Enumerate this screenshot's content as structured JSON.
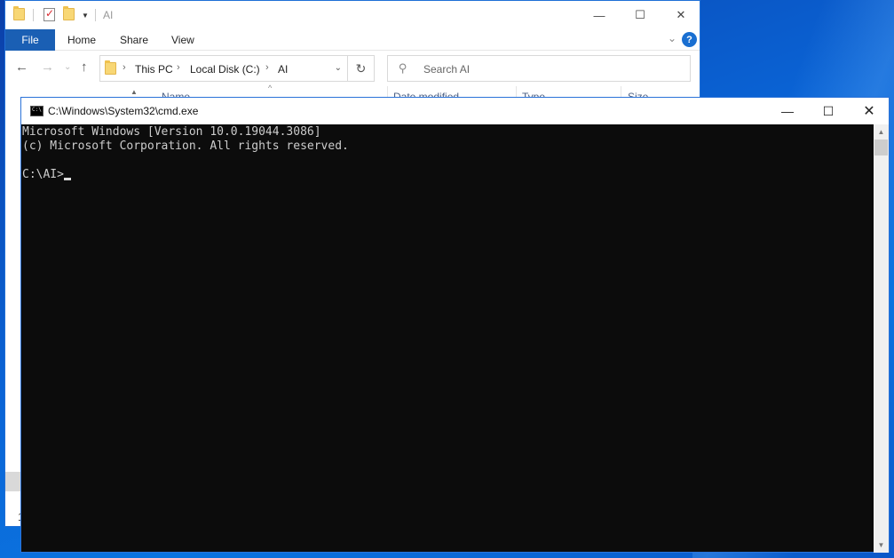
{
  "explorer": {
    "title": "AI",
    "ribbon_tabs": {
      "file": "File",
      "home": "Home",
      "share": "Share",
      "view": "View"
    },
    "breadcrumbs": [
      "This PC",
      "Local Disk (C:)",
      "AI"
    ],
    "search_placeholder": "Search AI",
    "columns": {
      "name": "Name",
      "date": "Date modified",
      "type": "Type",
      "size": "Size"
    },
    "status": "1"
  },
  "cmd": {
    "title": "C:\\Windows\\System32\\cmd.exe",
    "lines": [
      "Microsoft Windows [Version 10.0.19044.3086]",
      "(c) Microsoft Corporation. All rights reserved.",
      "",
      "C:\\AI>"
    ]
  },
  "colors": {
    "accent": "#1a5fb4",
    "console_bg": "#0c0c0c",
    "console_fg": "#cccccc"
  }
}
